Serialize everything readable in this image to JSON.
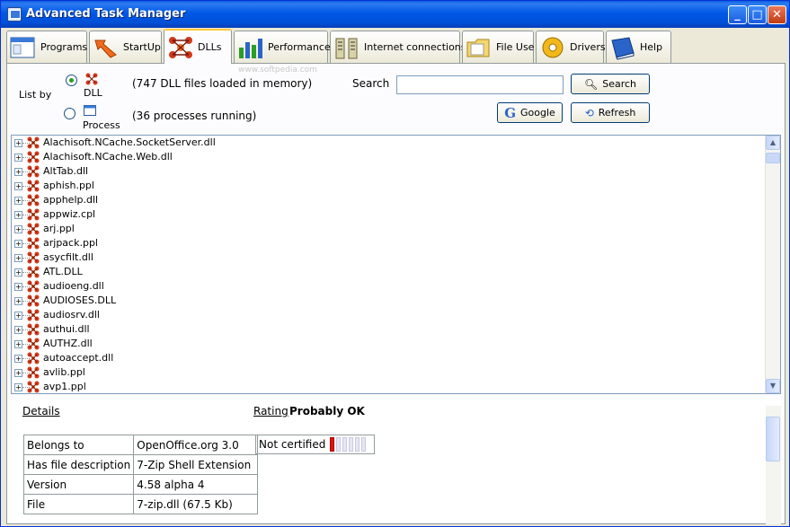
{
  "window": {
    "title": "Advanced Task Manager"
  },
  "tabs": [
    {
      "label": "Programs",
      "icon": "programs-icon"
    },
    {
      "label": "StartUp",
      "icon": "startup-icon"
    },
    {
      "label": "DLLs",
      "icon": "dlls-icon"
    },
    {
      "label": "Performance",
      "icon": "performance-icon"
    },
    {
      "label": "Internet connections",
      "icon": "internet-icon"
    },
    {
      "label": "File Use",
      "icon": "file-use-icon"
    },
    {
      "label": "Drivers",
      "icon": "drivers-icon"
    },
    {
      "label": "Help",
      "icon": "help-icon"
    }
  ],
  "active_tab": "DLLs",
  "toolbar": {
    "list_by_label": "List by",
    "dll_option": "DLL",
    "process_option": "Process",
    "dll_count_text": "(747 DLL files loaded in memory)",
    "process_count_text": "(36 processes running)",
    "search_label": "Search",
    "search_value": "",
    "search_button": "Search",
    "google_button": "Google",
    "refresh_button": "Refresh",
    "watermark": "www.softpedia.com"
  },
  "dll_list": [
    "Alachisoft.NCache.SocketServer.dll",
    "Alachisoft.NCache.Web.dll",
    "AltTab.dll",
    "aphish.ppl",
    "apphelp.dll",
    "appwiz.cpl",
    "arj.ppl",
    "arjpack.ppl",
    "asycfilt.dll",
    "ATL.DLL",
    "audioeng.dll",
    "AUDIOSES.DLL",
    "audiosrv.dll",
    "authui.dll",
    "AUTHZ.dll",
    "autoaccept.dll",
    "avlib.ppl",
    "avp1.ppl"
  ],
  "details": {
    "details_label": "Details",
    "rating_label": "Rating",
    "rating_value": "Probably OK",
    "certification": "Not certified",
    "rows": [
      {
        "key": "Belongs to",
        "value": "OpenOffice.org 3.0"
      },
      {
        "key": "Has file description",
        "value": "7-Zip Shell Extension"
      },
      {
        "key": "Version",
        "value": "4.58 alpha 4"
      },
      {
        "key": "File",
        "value": "7-zip.dll (67.5 Kb)"
      }
    ]
  },
  "colors": {
    "titlebar": "#0054e3",
    "rating_bar": "#e01010"
  }
}
